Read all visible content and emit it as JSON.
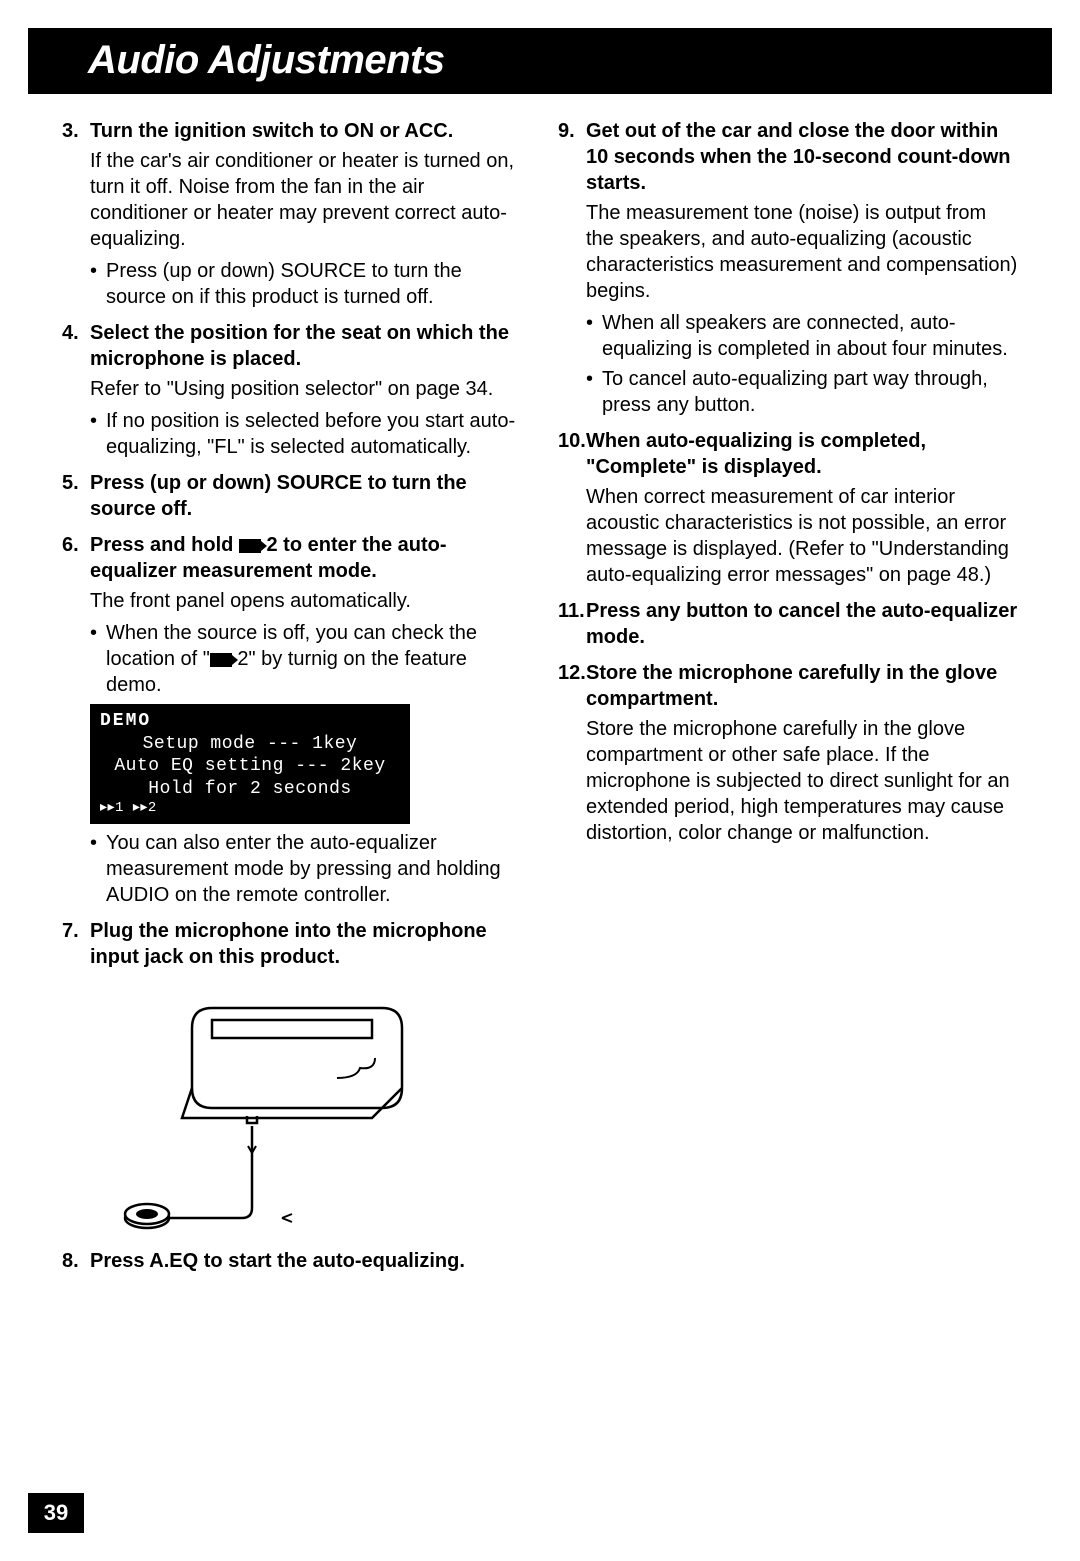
{
  "header": {
    "title": "Audio Adjustments"
  },
  "page_number": "39",
  "left": {
    "s3": {
      "num": "3.",
      "title": "Turn the ignition switch to ON or ACC.",
      "body": "If the car's air conditioner or heater is turned on, turn it off. Noise from the fan in the air conditioner or heater may prevent correct auto-equalizing.",
      "b1": "Press (up or down) SOURCE to turn the source on if this product is turned off."
    },
    "s4": {
      "num": "4.",
      "title": "Select the position for the seat on which the microphone is placed.",
      "body": "Refer to \"Using position selector\" on page 34.",
      "b1": "If no position is selected before you start auto-equalizing, \"FL\" is selected automatically."
    },
    "s5": {
      "num": "5.",
      "title": "Press (up or down) SOURCE to turn the source off."
    },
    "s6": {
      "num": "6.",
      "title_a": "Press and hold ",
      "title_b": " 2 to enter the auto-equalizer measurement mode.",
      "body": "The front panel opens automatically.",
      "b1_a": "When the source is off, you can check the location of \"",
      "b1_b": " 2\" by turnig on the feature demo.",
      "b2": "You can also enter the auto-equalizer measurement mode by pressing and holding AUDIO on the remote controller."
    },
    "demo": {
      "title": "DEMO",
      "l1": "Setup mode --- 1key",
      "l2": "Auto EQ setting --- 2key",
      "l3": "Hold for 2 seconds",
      "foot": "▸▸1  ▸▸2"
    },
    "s7": {
      "num": "7.",
      "title": "Plug the microphone into the microphone input jack on this product."
    },
    "s8": {
      "num": "8.",
      "title": "Press A.EQ to start the auto-equalizing."
    }
  },
  "right": {
    "s9": {
      "num": "9.",
      "title": "Get out of the car and close the door within 10 seconds when the 10-second count-down starts.",
      "body": "The measurement tone (noise) is output from the speakers, and auto-equalizing (acoustic characteristics measurement and compensation) begins.",
      "b1": "When all speakers are connected, auto-equalizing is completed in about four minutes.",
      "b2": "To cancel auto-equalizing part way through, press any button."
    },
    "s10": {
      "num": "10.",
      "title": "When auto-equalizing is completed, \"Complete\" is displayed.",
      "body": "When correct measurement of car interior acoustic characteristics is not possible, an error message is displayed. (Refer to \"Understanding auto-equalizing error messages\" on page 48.)"
    },
    "s11": {
      "num": "11.",
      "title": "Press any button to cancel the auto-equalizer mode."
    },
    "s12": {
      "num": "12.",
      "title": "Store the microphone carefully in the glove compartment.",
      "body": "Store the microphone carefully in the glove compartment or other safe place. If the microphone is subjected to direct sunlight for an extended period, high temperatures may cause distortion, color change or malfunction."
    }
  }
}
